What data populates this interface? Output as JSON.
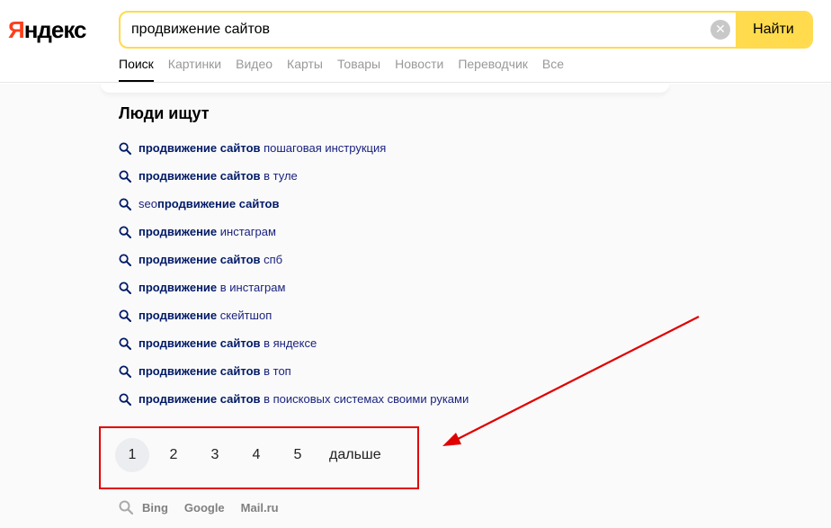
{
  "logo": {
    "first": "Я",
    "rest": "ндекс"
  },
  "search": {
    "value": "продвижение сайтов",
    "button_label": "Найти",
    "clear_glyph": "✕"
  },
  "tabs": [
    {
      "label": "Поиск",
      "active": true
    },
    {
      "label": "Картинки"
    },
    {
      "label": "Видео"
    },
    {
      "label": "Карты"
    },
    {
      "label": "Товары"
    },
    {
      "label": "Новости"
    },
    {
      "label": "Переводчик"
    },
    {
      "label": "Все"
    }
  ],
  "people_search": {
    "title": "Люди ищут",
    "items": [
      {
        "bold": "продвижение сайтов",
        "rest": " пошаговая инструкция",
        "bold_first": true
      },
      {
        "bold": "продвижение сайтов",
        "rest": " в туле",
        "bold_first": true
      },
      {
        "pre": "seo ",
        "bold": "продвижение сайтов",
        "rest": "",
        "bold_first": false
      },
      {
        "bold": "продвижение",
        "rest": " инстаграм",
        "bold_first": true
      },
      {
        "bold": "продвижение сайтов",
        "rest": " спб",
        "bold_first": true
      },
      {
        "bold": "продвижение",
        "rest": " в инстаграм",
        "bold_first": true
      },
      {
        "bold": "продвижение",
        "rest": " скейтшоп",
        "bold_first": true
      },
      {
        "bold": "продвижение сайтов",
        "rest": " в яндексе",
        "bold_first": true
      },
      {
        "bold": "продвижение сайтов",
        "rest": " в топ",
        "bold_first": true
      },
      {
        "bold": "продвижение сайтов",
        "rest": " в поисковых системах своими руками",
        "bold_first": true
      }
    ]
  },
  "pager": {
    "pages": [
      "1",
      "2",
      "3",
      "4",
      "5"
    ],
    "current": "1",
    "next_label": "дальше"
  },
  "other_engines": [
    "Bing",
    "Google",
    "Mail.ru"
  ],
  "colors": {
    "accent": "#ffdb4d",
    "logo_red": "#fc3f1d",
    "annotation_red": "#e00000",
    "link": "#001a66"
  }
}
